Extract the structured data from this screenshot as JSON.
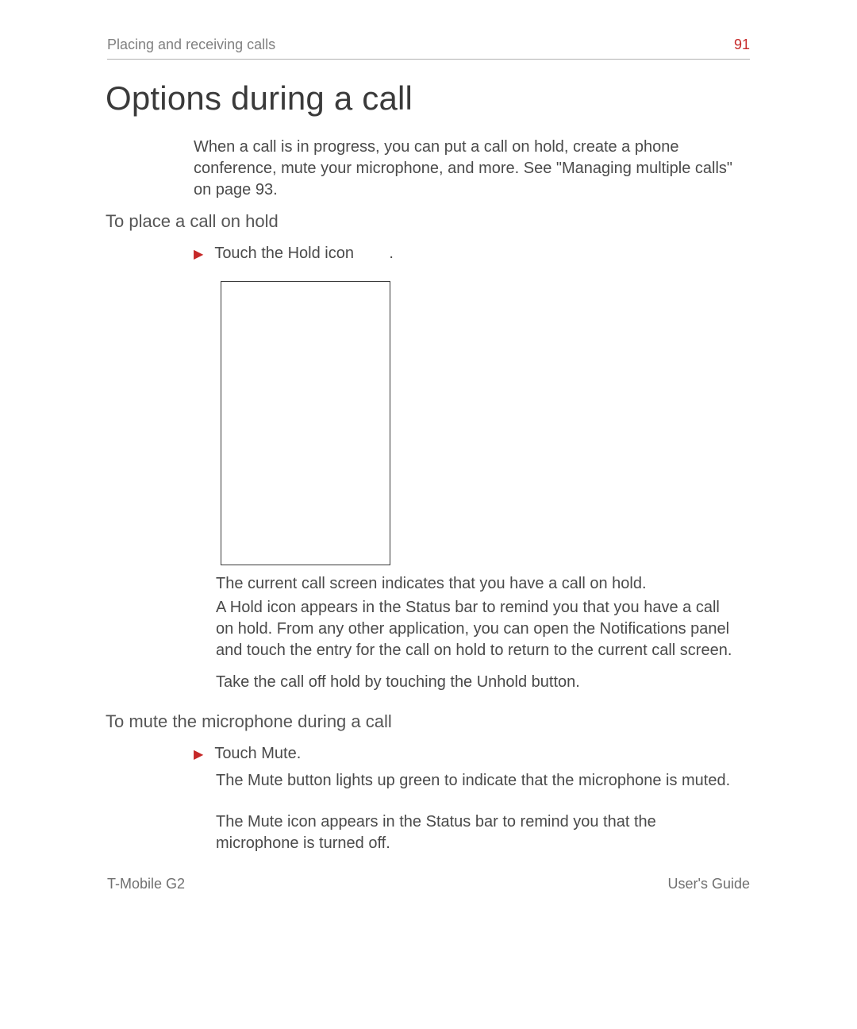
{
  "header": {
    "section": "Placing and receiving calls",
    "page_number": "91"
  },
  "title": "Options during a call",
  "intro": "When a call is in progress, you can put a call on hold, create a phone conference, mute your microphone, and more. See \"Managing multiple calls\" on page 93.",
  "sections": {
    "hold": {
      "heading": "To place a call on hold",
      "bullet": "Touch the Hold icon        .",
      "p1": "The current call screen indicates that you have a call on hold.",
      "p2": "A Hold        icon appears in the Status bar to remind you that you have a call on hold. From any other application, you can open the Notifications panel and touch the entry for the call on hold to return to the current call screen.",
      "p3": "Take the call off hold by touching the Unhold button."
    },
    "mute": {
      "heading": "To mute the microphone during a call",
      "bullet": "Touch Mute.",
      "p1": "The Mute button lights up green to indicate that the microphone is muted.",
      "p2": "The Mute icon appears in the Status bar to remind you that the microphone is turned off."
    }
  },
  "footer": {
    "left": "T-Mobile G2",
    "right": "User's Guide"
  }
}
